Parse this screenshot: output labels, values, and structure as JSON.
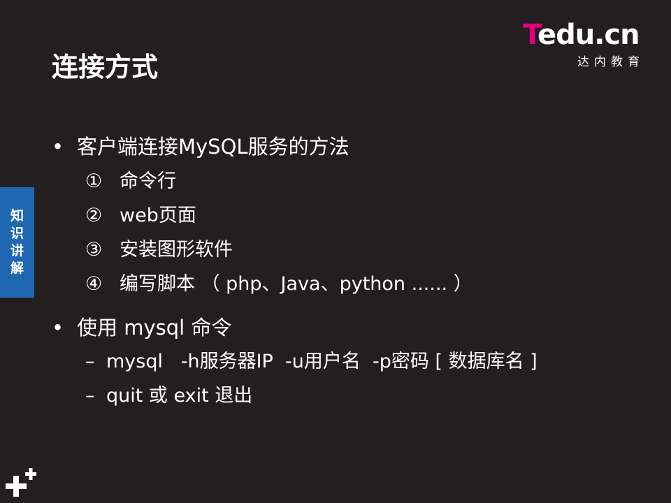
{
  "logo": {
    "brand_t": "T",
    "brand_rest": "edu.cn",
    "subtitle": "达内教育"
  },
  "slide": {
    "title": "连接方式",
    "side_tab": [
      "知",
      "识",
      "讲",
      "解"
    ],
    "bullets": [
      {
        "marker": "•",
        "text": "客户端连接MySQL服务的方法",
        "items": [
          {
            "num": "①",
            "text": "命令行"
          },
          {
            "num": "②",
            "text": "web页面"
          },
          {
            "num": "③",
            "text": "安装图形软件"
          },
          {
            "num": "④",
            "text": "编写脚本 （ php、Java、python ...... ）"
          }
        ]
      },
      {
        "marker": "•",
        "text": "使用 mysql 命令",
        "items": [
          {
            "num": "–",
            "text": "mysql   -h服务器IP  -u用户名  -p密码 [ 数据库名 ]"
          },
          {
            "num": "–",
            "text": "quit 或 exit 退出"
          }
        ]
      }
    ]
  },
  "icons": {
    "corner": "plus-icon"
  }
}
